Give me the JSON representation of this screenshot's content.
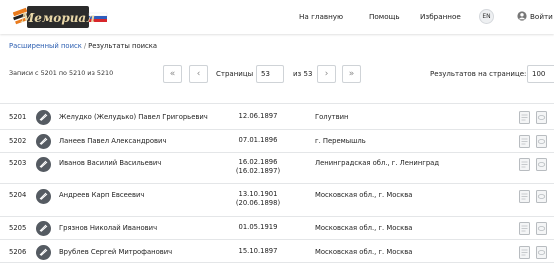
{
  "header": {
    "logo_text": "Мемориал",
    "nav": [
      "На главную",
      "Помощь",
      "Избранное"
    ],
    "lang": "EN",
    "login": "Войти"
  },
  "breadcrumb": {
    "link": "Расширенный поиск",
    "separator": "/",
    "current": "Результаты поиска"
  },
  "pagination": {
    "records_text": "Записи с 5201 по 5210 из 5210",
    "first": "«",
    "prev": "‹",
    "pages_label": "Страницы",
    "page": "53",
    "of_label": "из 53",
    "next": "›",
    "last": "»",
    "per_page_label": "Результатов на странице:",
    "per_page": "100"
  },
  "rows": [
    {
      "num": "5201",
      "name": "Желудко (Желудько) Павел Григорьевич",
      "date": "12.06.1897",
      "date2": "",
      "place": "Голутвин"
    },
    {
      "num": "5202",
      "name": "Ланеев Павел Александрович",
      "date": "07.01.1896",
      "date2": "",
      "place": "г. Перемышль"
    },
    {
      "num": "5203",
      "name": "Иванов Василий Васильевич",
      "date": "16.02.1896",
      "date2": "(16.02.1897)",
      "place": "Ленинградская обл., г. Ленинград"
    },
    {
      "num": "5204",
      "name": "Андреев Карп Евсеевич",
      "date": "13.10.1901",
      "date2": "(20.06.1898)",
      "place": "Московская обл., г. Москва"
    },
    {
      "num": "5205",
      "name": "Грязнов Николай Иванович",
      "date": "01.05.1919",
      "date2": "",
      "place": "Московская обл., г. Москва"
    },
    {
      "num": "5206",
      "name": "Врублев Сергей Митрофанович",
      "date": "15.10.1897",
      "date2": "",
      "place": "Московская обл., г. Москва"
    }
  ],
  "colors": {
    "link": "#2a5db0",
    "avatar": "#555b62",
    "border": "#e4e6e8",
    "ribbon_orange": "#e87a1d",
    "ribbon_black": "#222222"
  }
}
